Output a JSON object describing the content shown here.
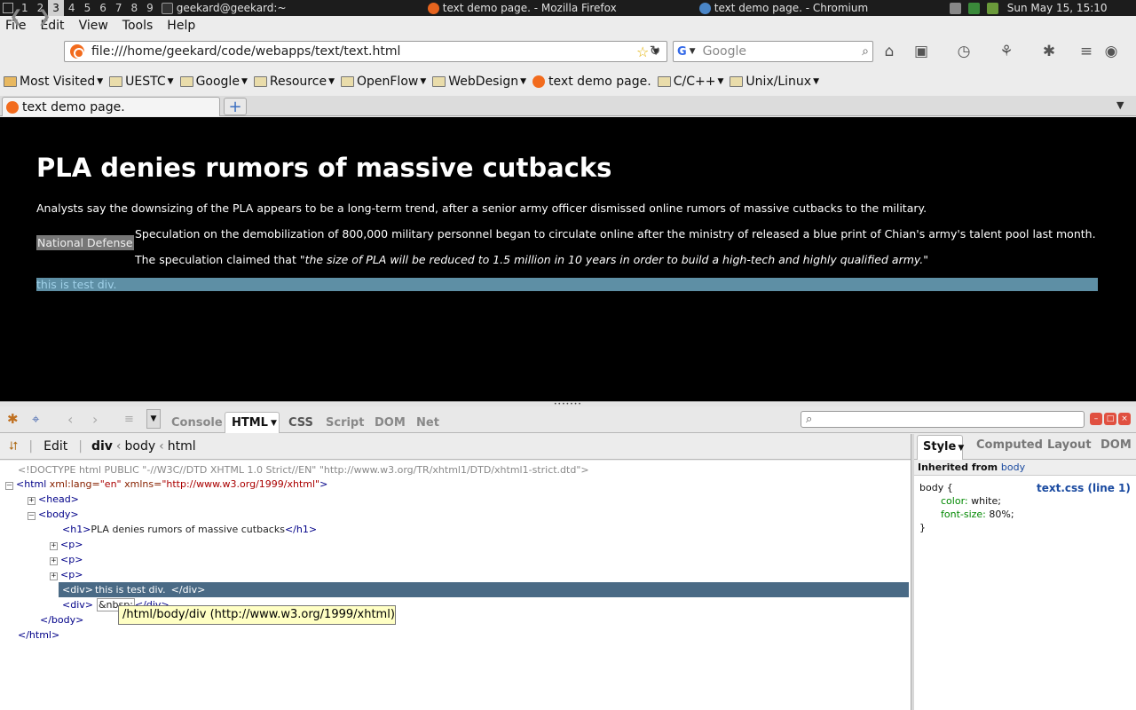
{
  "panel": {
    "workspaces": [
      "1",
      "2",
      "3",
      "4",
      "5",
      "6",
      "7",
      "8",
      "9"
    ],
    "active_workspace": "3",
    "terminal_title": "geekard@geekard:~",
    "firefox_title": "text demo page. - Mozilla Firefox",
    "chromium_title": "text demo page. - Chromium",
    "clock": "Sun May 15, 15:10"
  },
  "menubar": [
    "File",
    "Edit",
    "View",
    "Tools",
    "Help"
  ],
  "navbar": {
    "url": "file:///home/geekard/code/webapps/text/text.html",
    "search_placeholder": "Google"
  },
  "bookmarks": [
    "Most Visited",
    "UESTC",
    "Google",
    "Resource",
    "OpenFlow",
    "WebDesign",
    "text demo page.",
    "C/C++",
    "Unix/Linux"
  ],
  "tab": {
    "title": "text demo page."
  },
  "content": {
    "heading": "PLA denies rumors of massive cutbacks",
    "para1": "Analysts say the downsizing of the PLA appears to be a long-term trend, after a senior army officer dismissed online rumors of massive cutbacks to the military.",
    "tag": "National Defense",
    "para2": "Speculation on the demobilization of 800,000 military personnel began to circulate online after the ministry of released a blue print of Chian's army's talent pool last month.",
    "para3_prefix": "The speculation claimed that ",
    "para3_quote": "\"the size of PLA will be reduced to 1.5 million in 10 years in order to build a high-tech and highly qualified army.\"",
    "test_div": "this is test div."
  },
  "firebug": {
    "tabs": [
      "Console",
      "HTML",
      "CSS",
      "Script",
      "DOM",
      "Net"
    ],
    "edit_label": "Edit",
    "breadcrumb": [
      "div",
      "body",
      "html"
    ],
    "side_tabs": [
      "Style",
      "Computed",
      "Layout",
      "DOM"
    ],
    "tree": {
      "doctype": "<!DOCTYPE html PUBLIC \"-//W3C//DTD XHTML 1.0 Strict//EN\" \"http://www.w3.org/TR/xhtml1/DTD/xhtml1-strict.dtd\">",
      "html_open": "<html",
      "html_attr1": "xml:lang=",
      "html_val1": "\"en\"",
      "html_attr2": "xmlns=",
      "html_val2": "\"http://www.w3.org/1999/xhtml\"",
      "html_close_bracket": ">",
      "head": "<head>",
      "body": "<body>",
      "h1_open": "<h1>",
      "h1_text": "PLA denies rumors of massive cutbacks",
      "h1_close": "</h1>",
      "p": "<p>",
      "div_open": "<div>",
      "div_text": "this is test div.",
      "div_close": "</div>",
      "div2_text": "&nbsp;",
      "body_close": "</body>",
      "html_close": "</html>"
    },
    "tooltip": "/html/body/div  (http://www.w3.org/1999/xhtml)",
    "style": {
      "inherited_label": "Inherited from",
      "inherited_from": "body",
      "selector": "body {",
      "source": "text.css (line 1)",
      "prop1": "color:",
      "val1": "white;",
      "prop2": "font-size:",
      "val2": "80%;",
      "close": "}"
    }
  }
}
